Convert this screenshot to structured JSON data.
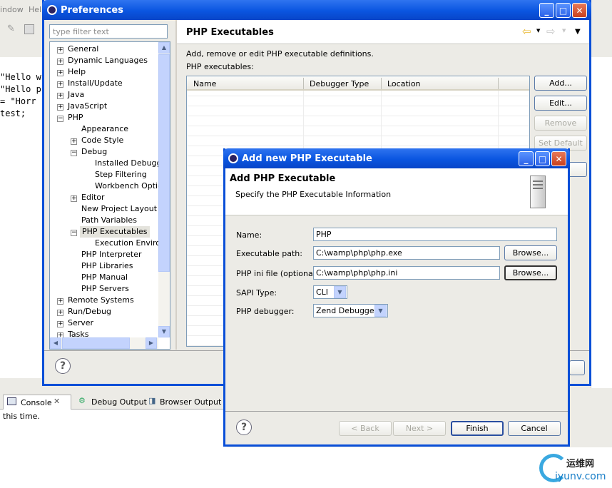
{
  "background": {
    "menu": [
      "indow",
      "Help"
    ],
    "code_lines": [
      "\"Hello w",
      "\"Hello p",
      "= \"Horr",
      "test;"
    ],
    "console_tabs": [
      "Console",
      "Debug Output",
      "Browser Output"
    ],
    "console_text": "this time."
  },
  "preferences": {
    "title": "Preferences",
    "filter_placeholder": "type filter text",
    "tree": {
      "general": "General",
      "dynamic_languages": "Dynamic Languages",
      "help": "Help",
      "install_update": "Install/Update",
      "java": "Java",
      "javascript": "JavaScript",
      "php": "PHP",
      "appearance": "Appearance",
      "code_style": "Code Style",
      "debug": "Debug",
      "installed_debuggers": "Installed Debugge",
      "step_filtering": "Step Filtering",
      "workbench_options": "Workbench Option",
      "editor": "Editor",
      "new_project_layout": "New Project Layout",
      "path_variables": "Path Variables",
      "php_executables": "PHP Executables",
      "execution_environments": "Execution Environ",
      "php_interpreter": "PHP Interpreter",
      "php_libraries": "PHP Libraries",
      "php_manual": "PHP Manual",
      "php_servers": "PHP Servers",
      "remote_systems": "Remote Systems",
      "run_debug": "Run/Debug",
      "server": "Server",
      "tasks": "Tasks"
    },
    "page_title": "PHP Executables",
    "description": "Add, remove or edit PHP executable definitions.",
    "list_label": "PHP executables:",
    "columns": [
      "Name",
      "Debugger Type",
      "Location"
    ],
    "buttons": {
      "add": "Add...",
      "edit": "Edit...",
      "remove": "Remove",
      "set_default": "Set Default"
    }
  },
  "dialog": {
    "title": "Add new PHP Executable",
    "header_title": "Add PHP Executable",
    "header_subtitle": "Specify the PHP Executable Information",
    "name_label": "Name:",
    "name_value": "PHP",
    "exe_label": "Executable path:",
    "exe_value": "C:\\wamp\\php\\php.exe",
    "ini_label": "PHP ini file (optional):",
    "ini_value": "C:\\wamp\\php\\php.ini",
    "browse": "Browse...",
    "sapi_label": "SAPI Type:",
    "sapi_value": "CLI",
    "debugger_label": "PHP debugger:",
    "debugger_value": "Zend Debugger",
    "buttons": {
      "back": "< Back",
      "next": "Next >",
      "finish": "Finish",
      "cancel": "Cancel"
    }
  },
  "watermark": {
    "text_cn": "运维网",
    "text_en": "iyunv.com"
  }
}
